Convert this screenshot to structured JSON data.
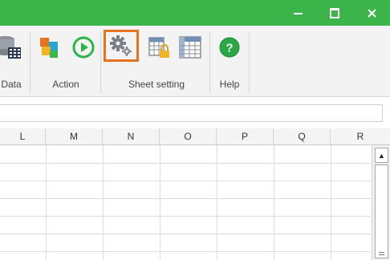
{
  "window": {
    "minimize_glyph": "—",
    "maximize_glyph": "☐",
    "close_glyph": "✕"
  },
  "ribbon": {
    "groups": [
      {
        "label": "Data"
      },
      {
        "label": "Action"
      },
      {
        "label": "Sheet setting"
      },
      {
        "label": "Help"
      }
    ],
    "tools": {
      "database": {
        "icon": "database-icon"
      },
      "cubes": {
        "icon": "cubes-icon"
      },
      "run": {
        "icon": "play-circle-icon"
      },
      "settings": {
        "icon": "gears-icon",
        "selected": true
      },
      "lock_sheet": {
        "icon": "locked-grid-icon"
      },
      "grid": {
        "icon": "grid-icon"
      },
      "help": {
        "icon": "help-circle-icon"
      }
    },
    "accent": "#e8731f"
  },
  "sheet": {
    "columns": [
      "L",
      "M",
      "N",
      "O",
      "P",
      "Q",
      "R"
    ],
    "scroll_up_glyph": "▲"
  },
  "colors": {
    "titlebar": "#3bb54a",
    "play": "#2cb34a",
    "help": "#2aa845"
  }
}
